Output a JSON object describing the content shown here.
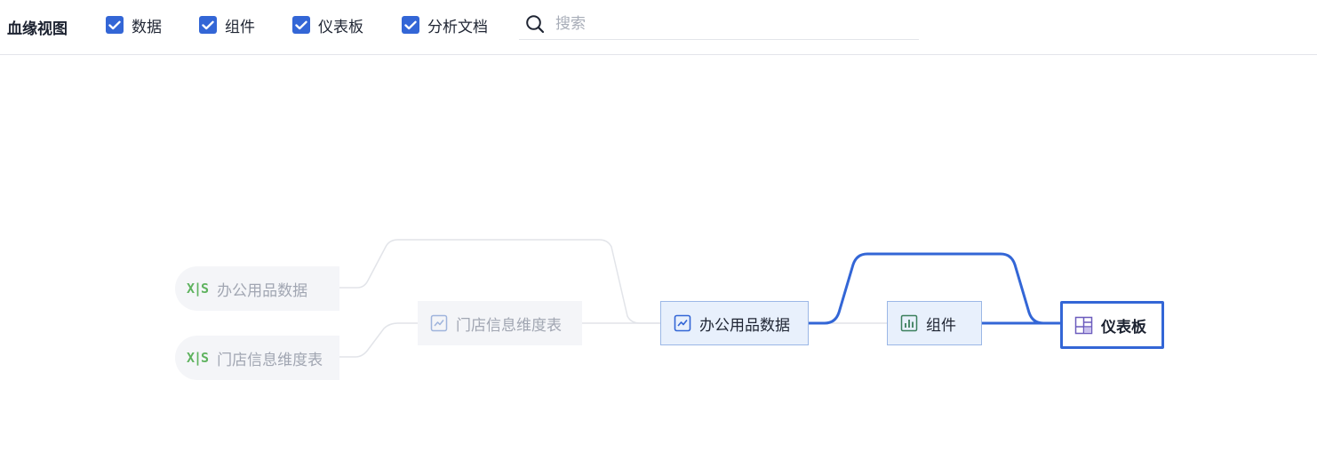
{
  "toolbar": {
    "title": "血缘视图",
    "filters": [
      {
        "label": "数据",
        "checked": true
      },
      {
        "label": "组件",
        "checked": true
      },
      {
        "label": "仪表板",
        "checked": true
      },
      {
        "label": "分析文档",
        "checked": true
      }
    ],
    "search": {
      "placeholder": "搜索",
      "value": ""
    }
  },
  "graph": {
    "nodes": {
      "src_office": {
        "label": "办公用品数据",
        "icon": "xls",
        "state": "faded"
      },
      "src_store": {
        "label": "门店信息维度表",
        "icon": "xls",
        "state": "faded"
      },
      "mid_store": {
        "label": "门店信息维度表",
        "icon": "dataset-chart-icon",
        "state": "faded"
      },
      "mid_office": {
        "label": "办公用品数据",
        "icon": "dataset-chart-icon",
        "state": "active"
      },
      "component": {
        "label": "组件",
        "icon": "bar-chart-icon",
        "state": "active"
      },
      "dashboard": {
        "label": "仪表板",
        "icon": "dashboard-grid-icon",
        "state": "selected"
      }
    },
    "colors": {
      "highlight": "#3366d6",
      "faded_line": "#e2e4e9",
      "xls": "#5fb35f"
    }
  }
}
